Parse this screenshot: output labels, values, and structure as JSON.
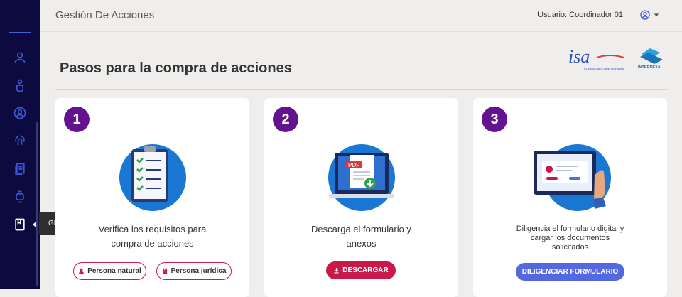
{
  "header": {
    "app_title": "Gestión De Acciones",
    "user_label": "Usuario: Coordinador 01"
  },
  "sidebar": {
    "items": [
      {
        "icon": "user-icon"
      },
      {
        "icon": "hand-icon"
      },
      {
        "icon": "user-circle-icon"
      },
      {
        "icon": "fingerprint-icon"
      },
      {
        "icon": "documents-icon"
      },
      {
        "icon": "watch-icon"
      },
      {
        "icon": "bookmark-book-icon"
      }
    ],
    "tooltip": "GESTIÓN DE ACCIONES"
  },
  "main": {
    "page_title": "Pasos para la compra de acciones"
  },
  "logos": {
    "isa": "isa",
    "isa_tagline": "CONEXIONES QUE INSPIRAN",
    "internexa": "INTERNEXA"
  },
  "cards": [
    {
      "number": "1",
      "text_line1": "Verifica los requisitos para",
      "text_line2": "compra de acciones",
      "buttons": [
        {
          "label": "Persona natural"
        },
        {
          "label": "Persona jurídica"
        }
      ]
    },
    {
      "number": "2",
      "text_line1": "Descarga el formulario y",
      "text_line2": "anexos",
      "buttons": [
        {
          "label": "DESCARGAR"
        }
      ]
    },
    {
      "number": "3",
      "text_line1": "Diligencia el formulario digital y",
      "text_line2": "cargar los documentos",
      "text_line3": "solicitados",
      "buttons": [
        {
          "label": "DILIGENCIAR FORMULARIO"
        }
      ]
    }
  ],
  "colors": {
    "sidebar": "#0c0a3e",
    "step_circle": "#63138f",
    "accent_red": "#c9184a",
    "accent_blue": "#5469e0"
  }
}
